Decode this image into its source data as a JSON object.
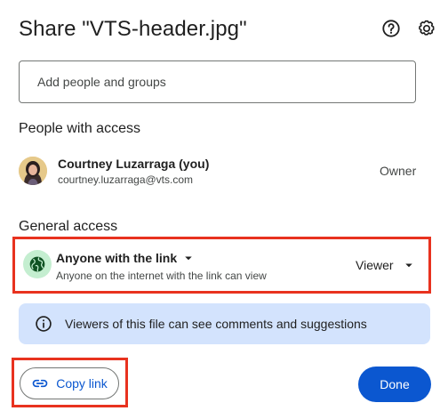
{
  "dialog": {
    "title": "Share \"VTS-header.jpg\""
  },
  "header_icons": {
    "help": "help-icon",
    "settings": "gear-icon"
  },
  "add_people": {
    "placeholder": "Add people and groups"
  },
  "people_section": {
    "title": "People with access",
    "people": [
      {
        "name": "Courtney Luzarraga (you)",
        "email": "courtney.luzarraga@vts.com",
        "role": "Owner"
      }
    ]
  },
  "general_access": {
    "title": "General access",
    "type_label": "Anyone with the link",
    "description": "Anyone on the internet with the link can view",
    "role": "Viewer"
  },
  "info_banner": {
    "text": "Viewers of this file can see comments and suggestions"
  },
  "actions": {
    "copy_link": "Copy link",
    "done": "Done"
  },
  "colors": {
    "accent": "#0b57d0",
    "highlight": "#e8321f",
    "banner": "#d3e3fd",
    "globe_bg": "#c4eed0"
  }
}
